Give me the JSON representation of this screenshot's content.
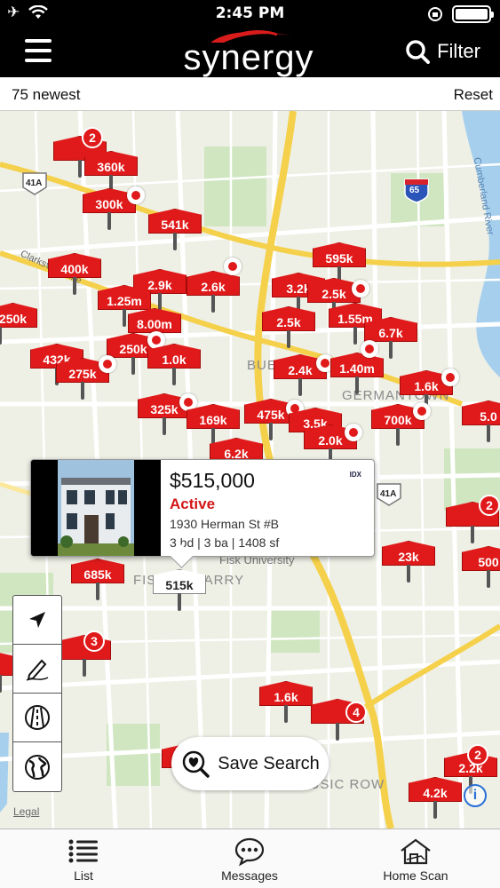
{
  "status_bar": {
    "time": "2:45 PM"
  },
  "header": {
    "brand": "synergy",
    "filter_label": "Filter"
  },
  "subbar": {
    "count_label": "75 newest",
    "reset_label": "Reset"
  },
  "colors": {
    "accent": "#e01a1a",
    "header_bg": "#000000"
  },
  "map": {
    "labels": [
      {
        "text": "BUE",
        "name": "map-label-bue"
      },
      {
        "text": "GERMANTOWN",
        "name": "map-label-germantown"
      },
      {
        "text": "Fisk University",
        "name": "map-label-fisk-university"
      },
      {
        "text": "FISK-MEHARRY",
        "name": "map-label-fisk-meharry"
      },
      {
        "text": "MUSIC ROW",
        "name": "map-label-music-row"
      },
      {
        "text": "Cumberland River",
        "name": "map-label-cumberland-river"
      },
      {
        "text": "Clarksville Pike",
        "name": "map-label-clarksville-pike"
      }
    ],
    "shields": [
      "41A",
      "65",
      "41A"
    ],
    "pins": [
      "360k",
      "300k",
      "541k",
      "400k",
      "2.9k",
      "2.6k",
      "1.25m",
      "595k",
      "3.2k",
      "2.5k",
      "1.55m",
      "250k",
      "8.00m",
      "2.5k",
      "6.7k",
      "432k",
      "250k",
      "1.0k",
      "275k",
      "2.4k",
      "1.40m",
      "1.6k",
      "325k",
      "169k",
      "475k",
      "3.5k",
      "2.0k",
      "700k",
      "5.0",
      "6.2k",
      "23k",
      "685k",
      "1.6k",
      "2.2k",
      "4.2k"
    ],
    "selected_pin": "515k",
    "cluster_counts": [
      "2",
      "3",
      "4",
      "2",
      "2"
    ]
  },
  "callout": {
    "price": "$515,000",
    "status": "Active",
    "address": "1930 Herman St #B",
    "specs": "3 bd | 3 ba | 1408 sf",
    "source_badge": "IDX"
  },
  "tools": [
    "location-arrow-icon",
    "draw-pencil-icon",
    "road-icon",
    "globe-icon"
  ],
  "save_search_label": "Save Search",
  "legal_label": "Legal",
  "tabs": [
    {
      "label": "List",
      "icon": "list-icon"
    },
    {
      "label": "Messages",
      "icon": "chat-bubble-icon"
    },
    {
      "label": "Home Scan",
      "icon": "home-scan-icon"
    }
  ]
}
